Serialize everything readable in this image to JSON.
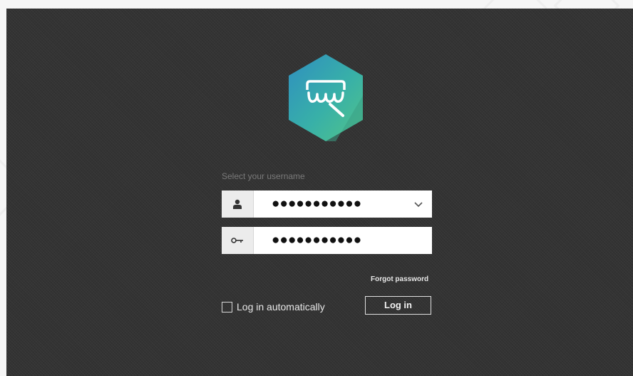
{
  "login": {
    "username_label": "Select your username",
    "username_value": "●●●●●●●●●●●",
    "password_value": "●●●●●●●●●●●",
    "forgot_password": "Forgot password",
    "auto_login_label": "Log in automatically",
    "auto_login_checked": false,
    "login_button": "Log in"
  },
  "icons": {
    "logo": "dental-teeth-logo-icon",
    "user": "user-icon",
    "key": "key-icon",
    "dropdown": "chevron-down-icon"
  },
  "colors": {
    "background": "#333333",
    "logo_teal": "#3fb5a0",
    "logo_blue": "#2a8fb8",
    "field_background": "#ffffff",
    "text_light": "#e8e8e8",
    "label_muted": "#7a7a7a"
  }
}
